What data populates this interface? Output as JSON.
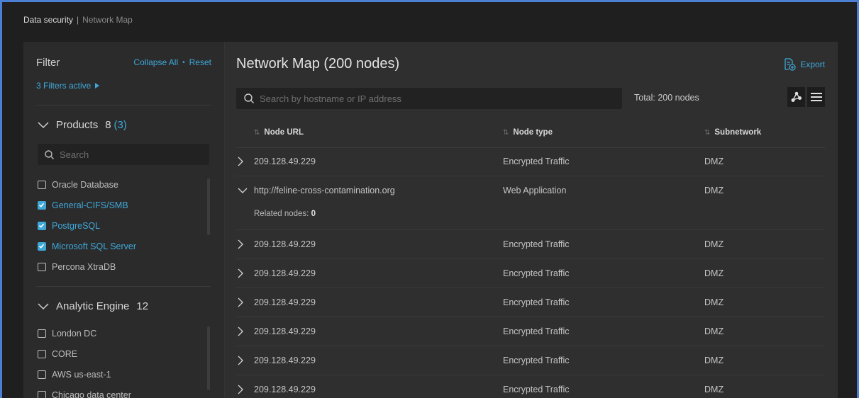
{
  "breadcrumb": {
    "root": "Data security",
    "separator": "|",
    "current": "Network Map"
  },
  "sidebar": {
    "title": "Filter",
    "collapse_all": "Collapse All",
    "reset": "Reset",
    "filters_active": "3 Filters active",
    "search_placeholder": "Search",
    "products": {
      "label": "Products",
      "count": "8",
      "selected": "(3)",
      "items": [
        {
          "label": "Oracle Database",
          "checked": false
        },
        {
          "label": "General-CIFS/SMB",
          "checked": true
        },
        {
          "label": "PostgreSQL",
          "checked": true
        },
        {
          "label": "Microsoft SQL Server",
          "checked": true
        },
        {
          "label": "Percona XtraDB",
          "checked": false
        }
      ]
    },
    "analytic_engine": {
      "label": "Analytic Engine",
      "count": "12",
      "items": [
        {
          "label": "London DC",
          "checked": false
        },
        {
          "label": "CORE",
          "checked": false
        },
        {
          "label": "AWS us-east-1",
          "checked": false
        },
        {
          "label": "Chicago data center",
          "checked": false
        }
      ]
    }
  },
  "main": {
    "title": "Network Map (200 nodes)",
    "export_label": "Export",
    "search_placeholder": "Search by hostname or IP address",
    "total": "Total: 200 nodes",
    "columns": [
      "Node URL",
      "Node type",
      "Subnetwork"
    ],
    "rows": [
      {
        "url": "209.128.49.229",
        "type": "Encrypted Traffic",
        "subnet": "DMZ",
        "expanded": false
      },
      {
        "url": "http://feline-cross-contamination.org",
        "type": "Web Application",
        "subnet": "DMZ",
        "expanded": true,
        "related_label": "Related nodes:",
        "related_count": "0"
      },
      {
        "url": "209.128.49.229",
        "type": "Encrypted Traffic",
        "subnet": "DMZ",
        "expanded": false
      },
      {
        "url": "209.128.49.229",
        "type": "Encrypted Traffic",
        "subnet": "DMZ",
        "expanded": false
      },
      {
        "url": "209.128.49.229",
        "type": "Encrypted Traffic",
        "subnet": "DMZ",
        "expanded": false
      },
      {
        "url": "209.128.49.229",
        "type": "Encrypted Traffic",
        "subnet": "DMZ",
        "expanded": false
      },
      {
        "url": "209.128.49.229",
        "type": "Encrypted Traffic",
        "subnet": "DMZ",
        "expanded": false
      },
      {
        "url": "209.128.49.229",
        "type": "Encrypted Traffic",
        "subnet": "DMZ",
        "expanded": false
      }
    ]
  },
  "colors": {
    "accent": "#3fa8d8",
    "background": "#1f1f20",
    "panel": "#2b2b2c"
  }
}
